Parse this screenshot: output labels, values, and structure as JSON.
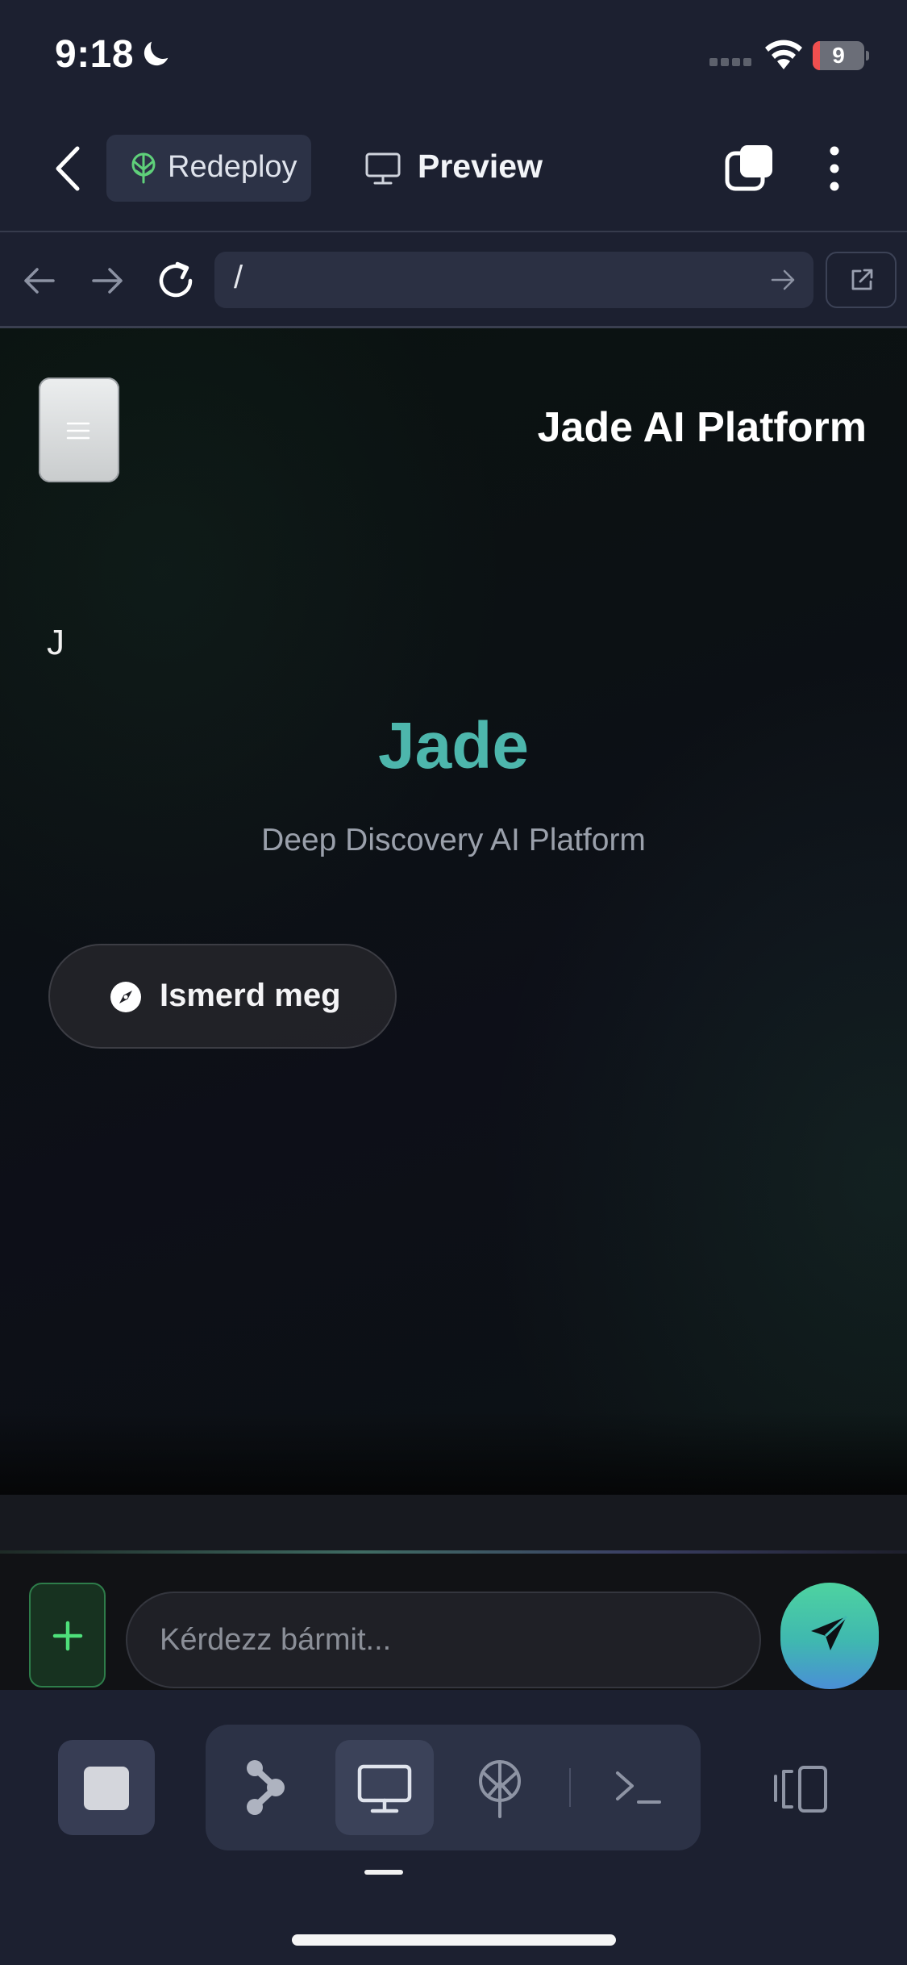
{
  "status_bar": {
    "time": "9:18",
    "battery": "9"
  },
  "header": {
    "redeploy_label": "Redeploy",
    "preview_label": "Preview"
  },
  "browser": {
    "url": "/"
  },
  "site": {
    "title": "Jade AI Platform",
    "avatar_initial": "J",
    "hero_title": "Jade",
    "hero_subtitle": "Deep Discovery AI Platform",
    "explore_label": "Ismerd meg"
  },
  "chat": {
    "placeholder": "Kérdezz bármit..."
  },
  "colors": {
    "accent_teal": "#4db6ac",
    "add_button_green": "#2e7d4a",
    "battery_low_red": "#ef4f4f"
  },
  "toolbar": {
    "icons": [
      "stop-icon",
      "agent-icon",
      "monitor-icon",
      "deploy-icon",
      "shell-icon",
      "devices-icon"
    ],
    "active": "monitor-icon"
  }
}
